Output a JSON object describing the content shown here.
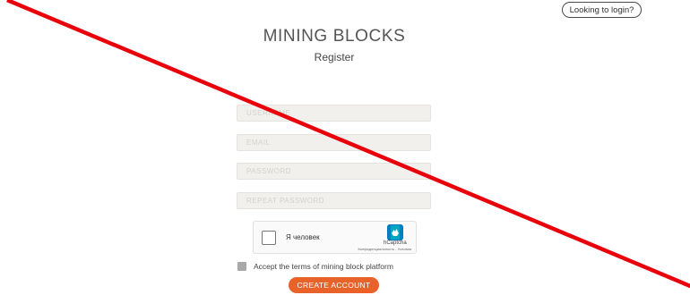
{
  "header": {
    "login_link": "Looking to login?"
  },
  "brand": {
    "title": "MINING BLOCKS",
    "subtitle": "Register"
  },
  "form": {
    "username_placeholder": "USERNAME",
    "email_placeholder": "EMAIL",
    "password_placeholder": "PASSWORD",
    "repeat_password_placeholder": "REPEAT PASSWORD",
    "terms_label": "Accept the terms of mining block platform",
    "terms_checked": false,
    "submit_label": "CREATE ACCOUNT"
  },
  "captcha": {
    "checkbox_label": "Я человек",
    "brand": "hCaptcha",
    "footer": "Конфиденциальность - Условия",
    "checked": false
  },
  "colors": {
    "accent": "#e8622a",
    "overlay_line": "#e8000b",
    "field_background": "#f2f0ed"
  }
}
